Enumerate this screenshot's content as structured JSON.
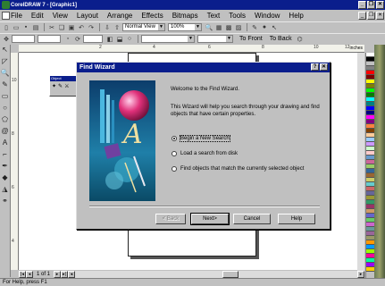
{
  "window": {
    "title": "CorelDRAW 7 - [Graphic1]",
    "min_glyph": "_",
    "max_glyph": "❐",
    "close_glyph": "✕"
  },
  "menu": {
    "items": [
      "File",
      "Edit",
      "View",
      "Layout",
      "Arrange",
      "Effects",
      "Bitmaps",
      "Text",
      "Tools",
      "Window",
      "Help"
    ]
  },
  "toolbar": {
    "view_mode": "Normal View",
    "zoom": "100%",
    "to_front": "To Front",
    "to_back": "To Back"
  },
  "ruler": {
    "h_labels": [
      "2",
      "4",
      "6",
      "8",
      "10",
      "12"
    ],
    "v_labels": [
      "10",
      "8",
      "6",
      "4"
    ],
    "unit": "inches"
  },
  "dialog": {
    "title": "Find Wizard",
    "help_glyph": "?",
    "close_glyph": "✕",
    "heading": "Welcome to the Find Wizard.",
    "description": "This Wizard will help you search through your drawing and find objects that have certain properties.",
    "options": [
      {
        "label": "Begin a New Search",
        "selected": true
      },
      {
        "label": "Load a search from disk",
        "selected": false
      },
      {
        "label": "Find objects that match the currently selected object",
        "selected": false
      }
    ],
    "buttons": {
      "back": "< Back",
      "next": "Next>",
      "cancel": "Cancel",
      "help": "Help"
    }
  },
  "floating": {
    "title": "Object"
  },
  "navigation": {
    "page_label": "1 of 1"
  },
  "status": {
    "text": "For Help, press F1"
  },
  "palette_colors": [
    "#ffffff",
    "#000000",
    "#c0c0c0",
    "#808080",
    "#ff0000",
    "#800000",
    "#ffff00",
    "#808000",
    "#00ff00",
    "#008000",
    "#00ffff",
    "#008080",
    "#0000ff",
    "#000080",
    "#ff00ff",
    "#800080",
    "#ff8040",
    "#804000",
    "#ffcc99",
    "#99ccff",
    "#cc99ff",
    "#ccffcc",
    "#ffcccc",
    "#6699cc",
    "#cc6699",
    "#99cc66",
    "#336699",
    "#996633",
    "#cccc66",
    "#66cccc",
    "#cc6666",
    "#666699",
    "#999933",
    "#339966",
    "#993366",
    "#cc9966",
    "#6666cc",
    "#66cc66",
    "#cc66cc",
    "#669999",
    "#996699",
    "#999966",
    "#ff9900",
    "#0099ff",
    "#99ff00",
    "#ff0099",
    "#00ff99",
    "#9900ff",
    "#ffcc00"
  ]
}
